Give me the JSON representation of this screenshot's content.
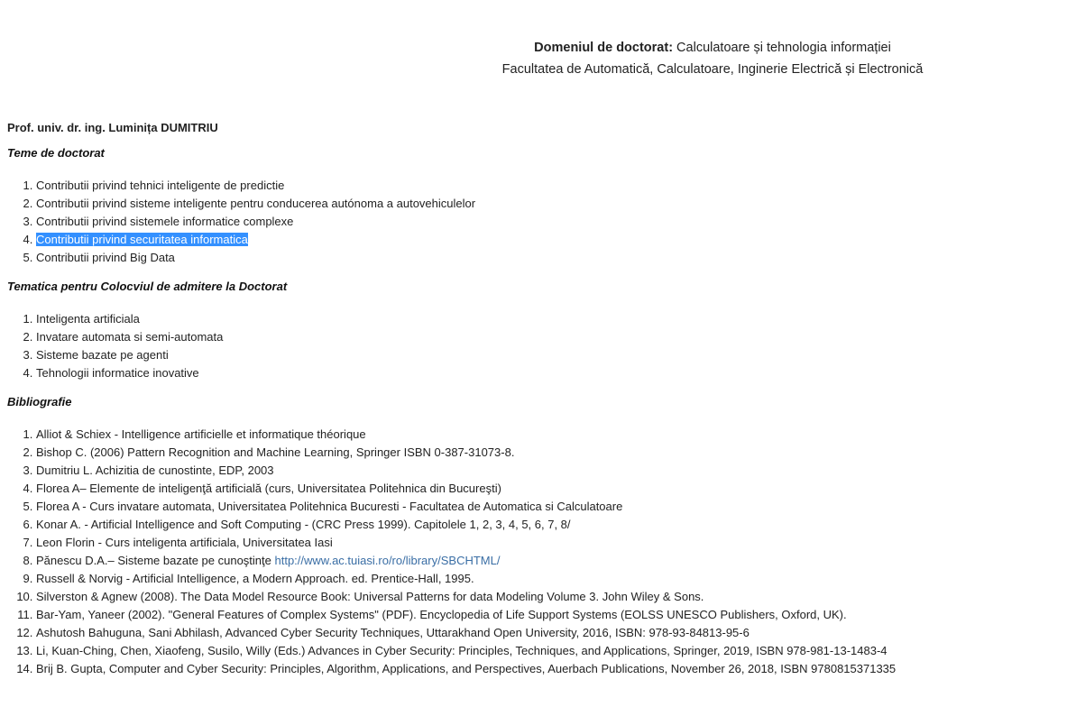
{
  "header": {
    "domain_label": "Domeniul de doctorat:",
    "domain_value": " Calculatoare și tehnologia informației",
    "faculty": "Facultatea de Automatică, Calculatoare, Inginerie Electrică și Electronică"
  },
  "professor": "Prof. univ. dr. ing. Luminița DUMITRIU",
  "themes": {
    "title": "Teme de doctorat",
    "items": [
      "Contributii privind tehnici inteligente de predictie",
      "Contributii privind sisteme inteligente pentru conducerea autónoma a autovehiculelor",
      "Contributii privind sistemele informatice complexe",
      "Contributii privind securitatea informatica",
      "Contributii privind Big Data"
    ],
    "selected_index": 3
  },
  "colloquium": {
    "title": "Tematica pentru Colocviul de admitere la Doctorat",
    "items": [
      "Inteligenta artificiala",
      "Invatare automata si semi-automata",
      "Sisteme bazate pe agenti",
      "Tehnologii informatice inovative"
    ]
  },
  "bibliography": {
    "title": "Bibliografie",
    "items": [
      "Alliot & Schiex - Intelligence artificielle et informatique théorique",
      "Bishop C. (2006) Pattern Recognition and Machine Learning, Springer ISBN 0-387-31073-8.",
      "Dumitriu L.  Achizitia de cunostinte, EDP, 2003",
      "Florea A– Elemente de inteligenţă artificială (curs, Universitatea Politehnica din Bucureşti)",
      "Florea A - Curs invatare automata, Universitatea Politehnica Bucuresti - Facultatea de Automatica si Calculatoare",
      "Konar A. - Artificial Intelligence and Soft Computing - (CRC Press 1999). Capitolele 1, 2, 3, 4, 5, 6, 7, 8/",
      "Leon Florin - Curs inteligenta artificiala, Universitatea Iasi",
      "Pănescu D.A.– Sisteme bazate pe cunoştinţe ",
      "Russell & Norvig - Artificial Intelligence, a Modern Approach. ed. Prentice-Hall, 1995.",
      "Silverston & Agnew (2008). The Data Model Resource Book: Universal Patterns for data Modeling Volume 3. John Wiley & Sons.",
      "Bar-Yam, Yaneer (2002). \"General Features of Complex Systems\" (PDF). Encyclopedia of Life Support Systems (EOLSS UNESCO Publishers, Oxford, UK).",
      "Ashutosh Bahuguna, Sani Abhilash, Advanced Cyber Security Techniques, Uttarakhand Open University, 2016, ISBN: 978-93-84813-95-6",
      "Li, Kuan-Ching, Chen, Xiaofeng, Susilo, Willy (Eds.) Advances in Cyber Security: Principles, Techniques, and Applications, Springer, 2019, ISBN 978-981-13-1483-4",
      "Brij B. Gupta, Computer and Cyber Security: Principles, Algorithm, Applications, and Perspectives, Auerbach Publications, November 26, 2018, ISBN 9780815371335"
    ],
    "link": {
      "index": 7,
      "text": "http://www.ac.tuiasi.ro/ro/library/SBCHTML/"
    }
  },
  "colors": {
    "selection_background": "#3390ff",
    "link": "#3a6ea5"
  }
}
